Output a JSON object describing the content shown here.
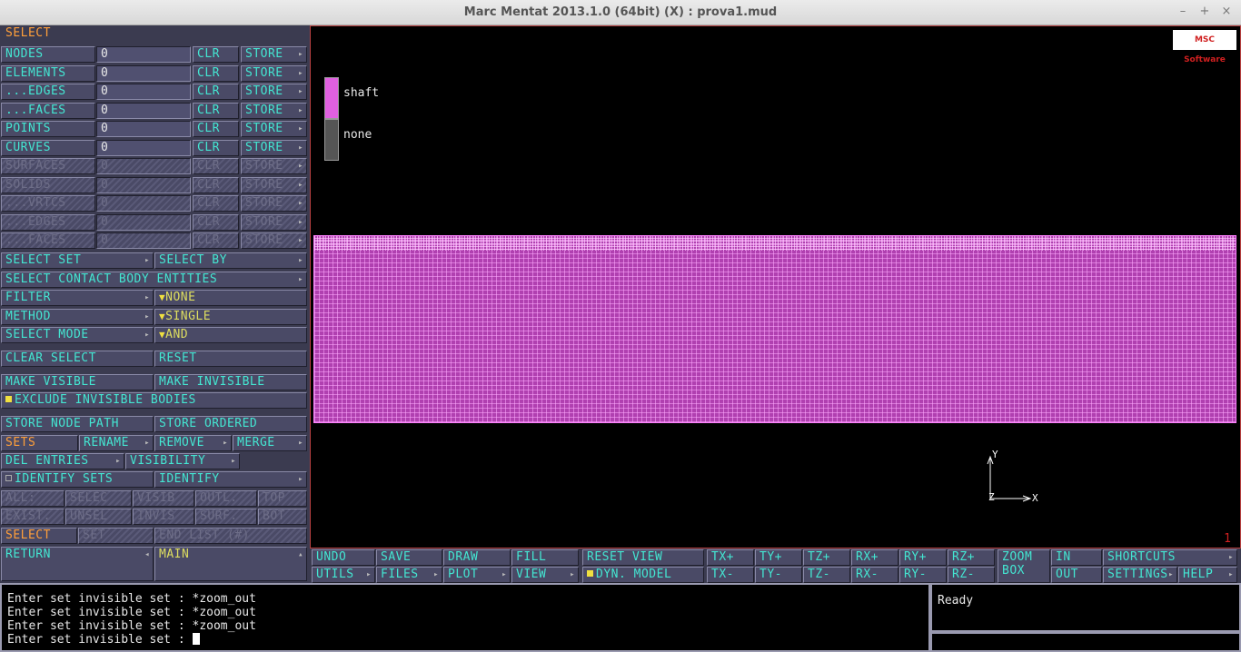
{
  "window": {
    "title": "Marc Mentat 2013.1.0 (64bit) (X) : prova1.mud",
    "minimize": "–",
    "maximize": "+",
    "close": "×"
  },
  "select_panel": {
    "header": "SELECT",
    "entity_rows": [
      {
        "label": "NODES",
        "value": "0",
        "clr": "CLR",
        "store": "STORE",
        "enabled": true
      },
      {
        "label": "ELEMENTS",
        "value": "0",
        "clr": "CLR",
        "store": "STORE",
        "enabled": true
      },
      {
        "label": "...EDGES",
        "value": "0",
        "clr": "CLR",
        "store": "STORE",
        "enabled": true
      },
      {
        "label": "...FACES",
        "value": "0",
        "clr": "CLR",
        "store": "STORE",
        "enabled": true
      },
      {
        "label": "POINTS",
        "value": "0",
        "clr": "CLR",
        "store": "STORE",
        "enabled": true
      },
      {
        "label": "CURVES",
        "value": "0",
        "clr": "CLR",
        "store": "STORE",
        "enabled": true
      },
      {
        "label": "SURFACES",
        "value": "0",
        "clr": "CLR",
        "store": "STORE",
        "enabled": false
      },
      {
        "label": "SOLIDS",
        "value": "0",
        "clr": "CLR",
        "store": "STORE",
        "enabled": false
      },
      {
        "label": "...VRTCS",
        "value": "0",
        "clr": "CLR",
        "store": "STORE",
        "enabled": false
      },
      {
        "label": "...EDGES",
        "value": "0",
        "clr": "CLR",
        "store": "STORE",
        "enabled": false
      },
      {
        "label": "...FACES",
        "value": "0",
        "clr": "CLR",
        "store": "STORE",
        "enabled": false
      }
    ],
    "select_set": "SELECT SET",
    "select_by": "SELECT BY",
    "select_contact": "SELECT CONTACT BODY ENTITIES",
    "filter_label": "FILTER",
    "filter_value": "NONE",
    "method_label": "METHOD",
    "method_value": "SINGLE",
    "mode_label": "SELECT MODE",
    "mode_value": "AND",
    "clear_select": "CLEAR SELECT",
    "reset": "RESET",
    "make_visible": "MAKE VISIBLE",
    "make_invisible": "MAKE INVISIBLE",
    "exclude_invisible": "EXCLUDE INVISIBLE BODIES",
    "store_node_path": "STORE NODE PATH",
    "store_ordered": "STORE ORDERED",
    "sets": "SETS",
    "rename": "RENAME",
    "remove": "REMOVE",
    "merge": "MERGE",
    "del_entries": "DEL ENTRIES",
    "visibility": "VISIBILITY",
    "identify_sets": "IDENTIFY SETS",
    "identify": "IDENTIFY",
    "grid_row1": [
      "ALL:",
      "SELEC",
      "VISIB",
      "OUTL.",
      "TOP"
    ],
    "grid_row2": [
      "EXIST.",
      "UNSEL",
      "INVIS",
      "SURF.",
      "BOT"
    ],
    "select_footer": "SELECT",
    "set_button": "SET",
    "end_list": "END LIST (#)",
    "return": "RETURN",
    "main": "MAIN"
  },
  "viewport": {
    "logo": "MSC Software",
    "legend": [
      {
        "label": "shaft",
        "color": "#e060e0"
      },
      {
        "label": "none",
        "color": "#555555"
      }
    ],
    "axis_y": "Y",
    "axis_x": "X",
    "axis_z": "Z",
    "view_number": "1"
  },
  "toolbar": {
    "undo": "UNDO",
    "save": "SAVE",
    "draw": "DRAW",
    "fill": "FILL",
    "utils": "UTILS",
    "files": "FILES",
    "plot": "PLOT",
    "view": "VIEW",
    "reset_view": "RESET VIEW",
    "dyn_model": "DYN. MODEL",
    "tx_plus": "TX+",
    "ty_plus": "TY+",
    "tz_plus": "TZ+",
    "rx_plus": "RX+",
    "ry_plus": "RY+",
    "rz_plus": "RZ+",
    "tx_minus": "TX-",
    "ty_minus": "TY-",
    "tz_minus": "TZ-",
    "rx_minus": "RX-",
    "ry_minus": "RY-",
    "rz_minus": "RZ-",
    "zoom": "ZOOM",
    "box": "BOX",
    "in": "IN",
    "out": "OUT",
    "shortcuts": "SHORTCUTS",
    "settings": "SETTINGS",
    "help": "HELP"
  },
  "console": {
    "lines": [
      "Enter set invisible set : *zoom_out",
      "Enter set invisible set : *zoom_out",
      "Enter set invisible set : *zoom_out"
    ],
    "prompt": "Enter set invisible set : "
  },
  "status": {
    "text": "Ready"
  }
}
